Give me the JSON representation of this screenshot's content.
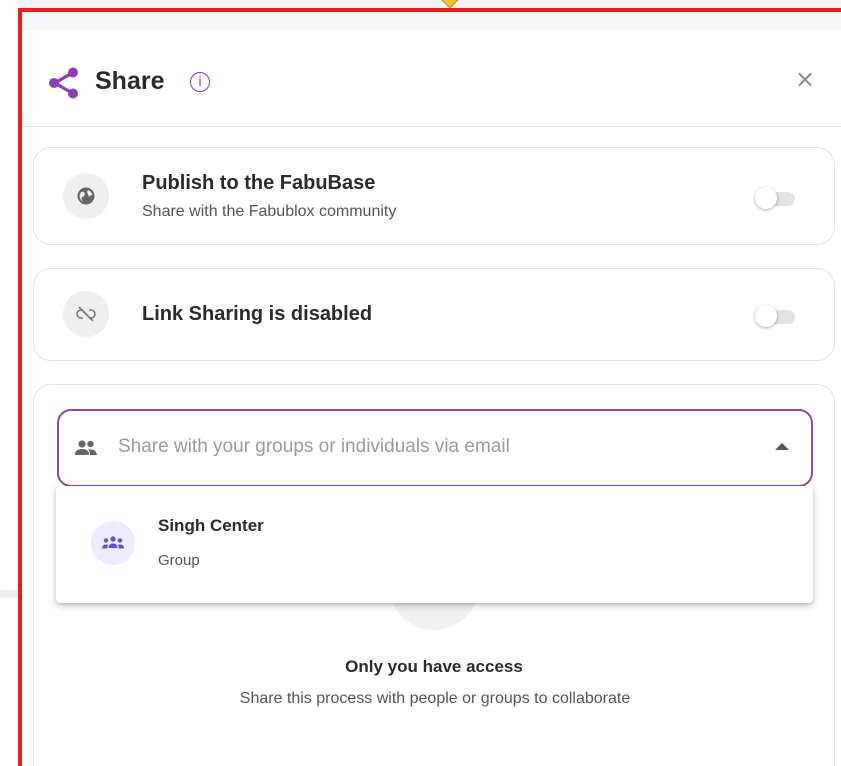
{
  "header": {
    "title": "Share",
    "close_glyph": "×",
    "icons": {
      "share": "share-icon",
      "info": "info-icon",
      "close": "close-icon"
    },
    "accent_color": "#8b3fb3"
  },
  "publish": {
    "title": "Publish to the FabuBase",
    "subtitle": "Share with the Fabublox community",
    "icon": "globe-icon",
    "enabled": false
  },
  "link_sharing": {
    "title": "Link Sharing is disabled",
    "icon": "link-off-icon",
    "enabled": false
  },
  "share_input": {
    "placeholder": "Share with your groups or individuals via email",
    "icon": "people-icon",
    "border_color": "#8b4aa8"
  },
  "dropdown": {
    "options": [
      {
        "name": "Singh Center",
        "type": "Group",
        "icon": "group-icon"
      }
    ]
  },
  "empty_state": {
    "title": "Only you have access",
    "subtitle": "Share this process with people or groups to collaborate"
  },
  "colors": {
    "highlight_frame": "#ee1c1c"
  }
}
